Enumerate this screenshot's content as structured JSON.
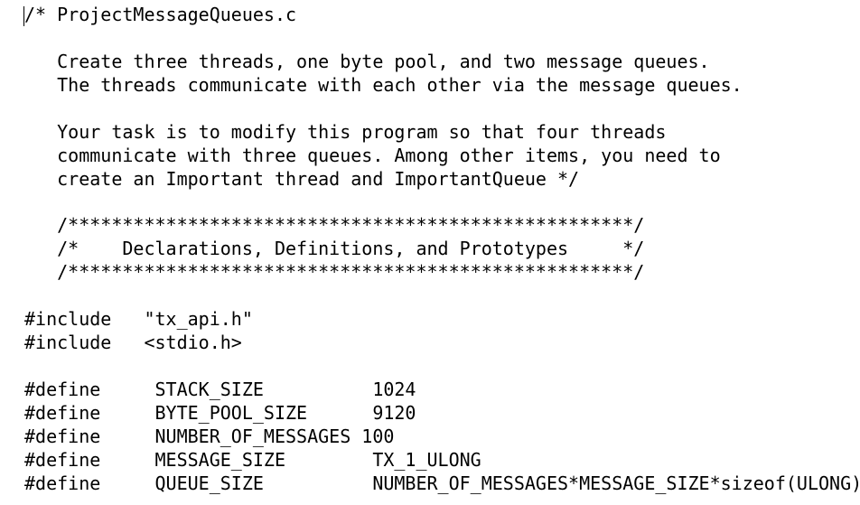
{
  "editor": {
    "lines": [
      "/* ProjectMessageQueues.c",
      "",
      "   Create three threads, one byte pool, and two message queues.",
      "   The threads communicate with each other via the message queues.",
      "",
      "   Your task is to modify this program so that four threads",
      "   communicate with three queues. Among other items, you need to",
      "   create an Important thread and ImportantQueue */",
      "",
      "   /****************************************************/",
      "   /*    Declarations, Definitions, and Prototypes     */",
      "   /****************************************************/",
      "",
      "#include   \"tx_api.h\"",
      "#include   <stdio.h>",
      "",
      "#define     STACK_SIZE          1024",
      "#define     BYTE_POOL_SIZE      9120",
      "#define     NUMBER_OF_MESSAGES 100",
      "#define     MESSAGE_SIZE        TX_1_ULONG",
      "#define     QUEUE_SIZE          NUMBER_OF_MESSAGES*MESSAGE_SIZE*sizeof(ULONG)"
    ]
  }
}
